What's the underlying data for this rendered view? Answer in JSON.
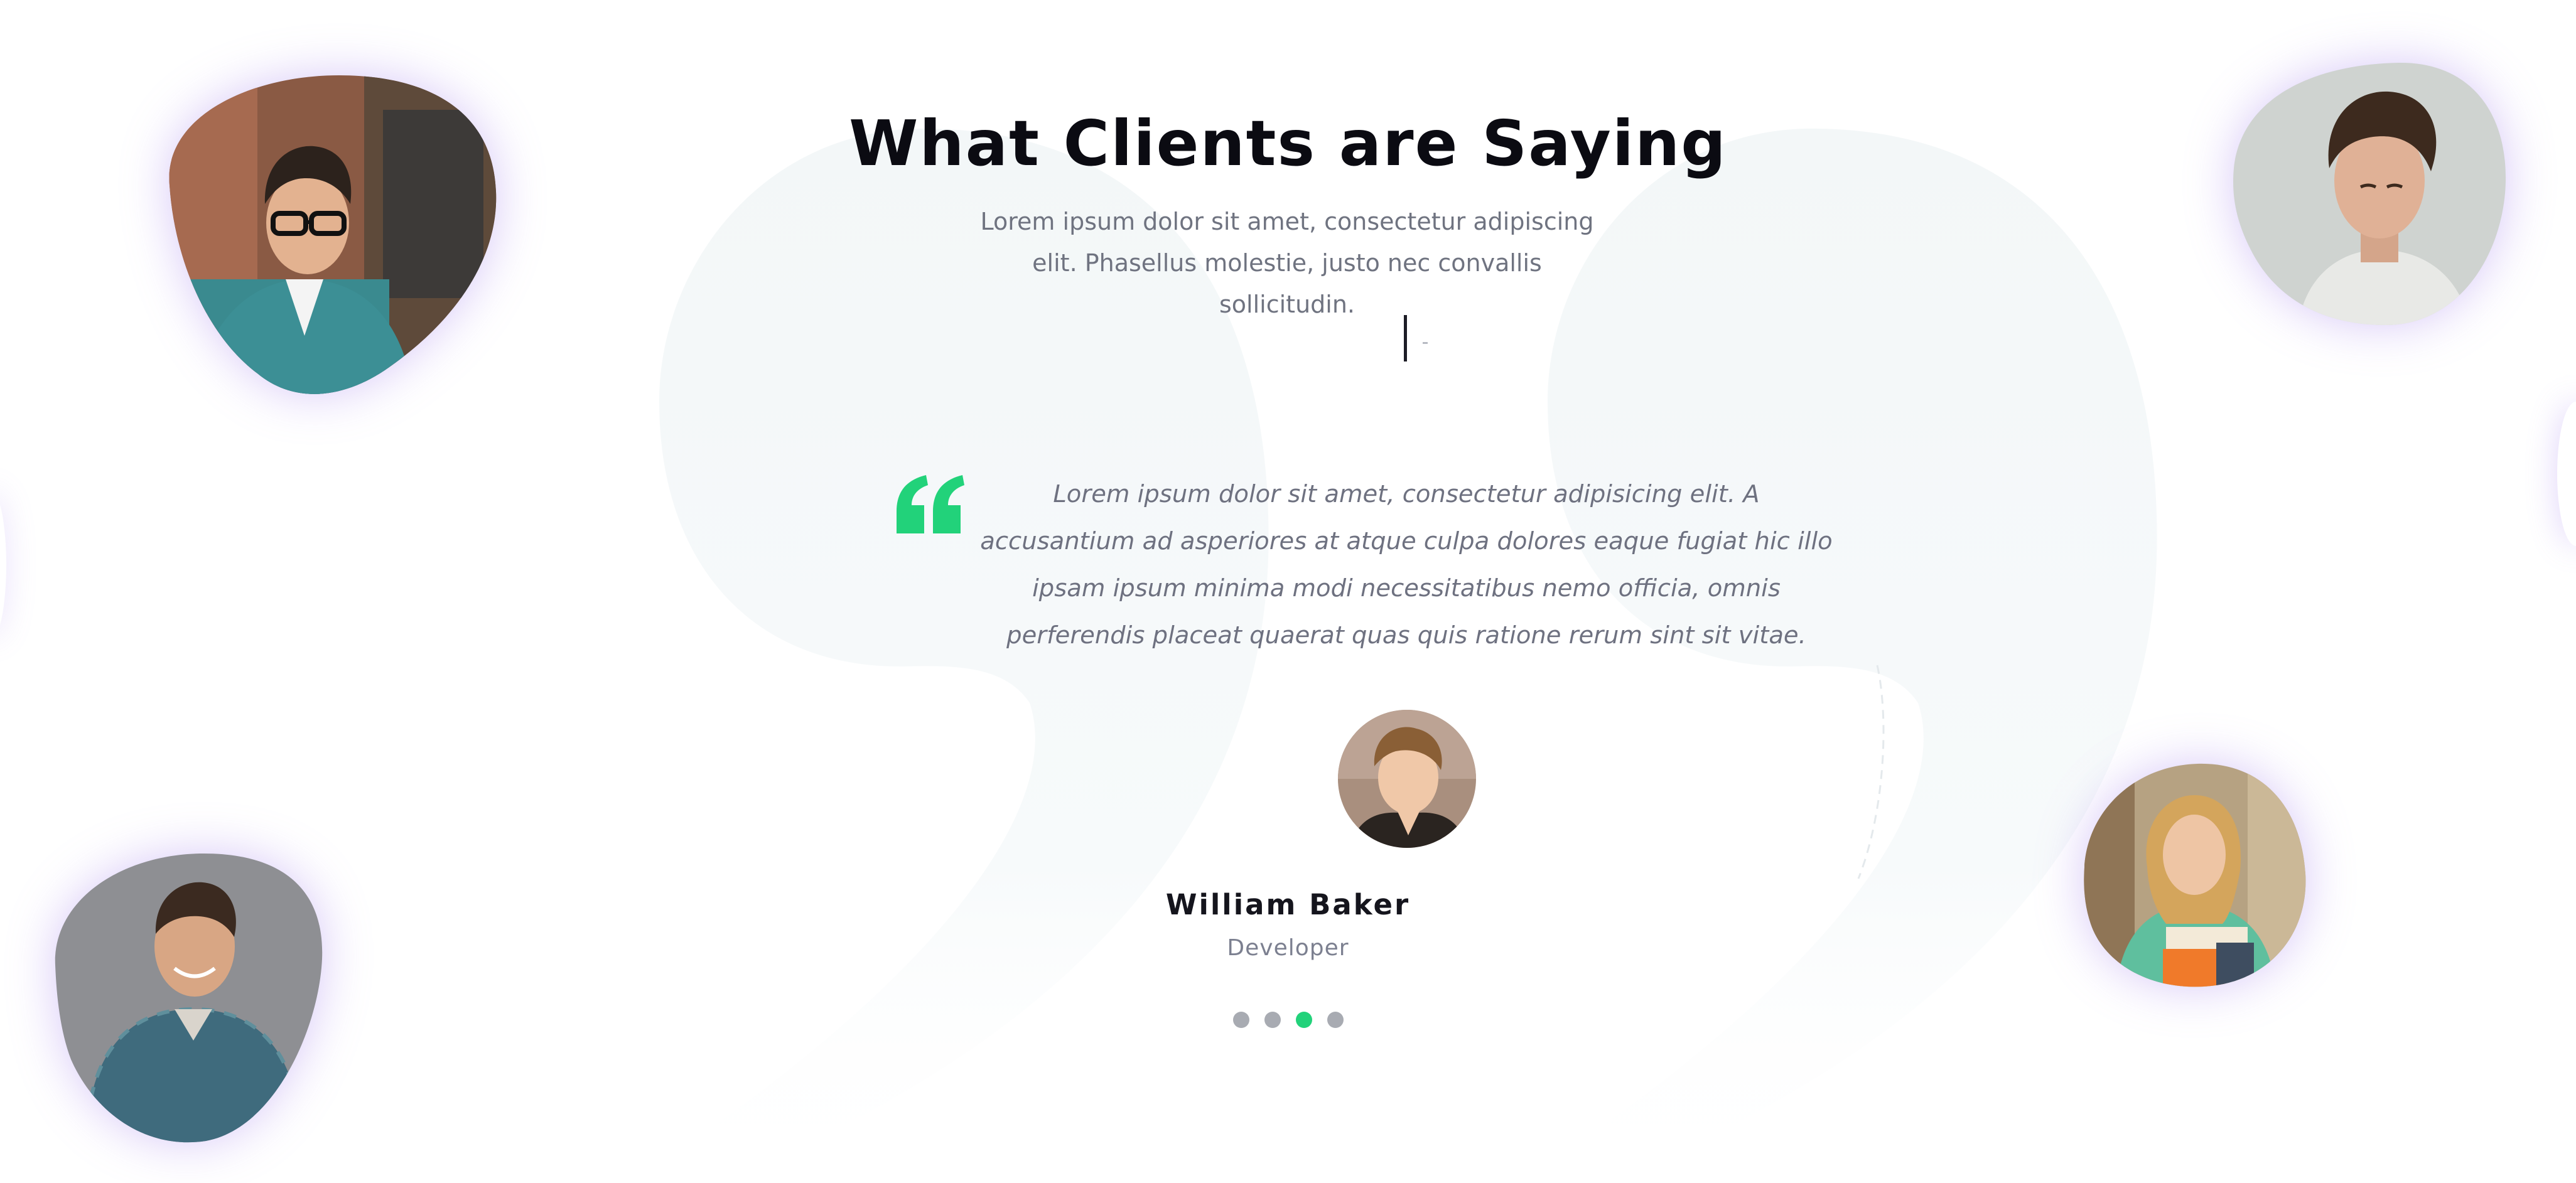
{
  "section": {
    "title": "What Clients are Saying",
    "subtitle": "Lorem ipsum dolor sit amet, consectetur adipiscing elit. Phasellus molestie, justo nec convallis sollicitudin."
  },
  "testimonial": {
    "quote": "Lorem ipsum dolor sit amet, consectetur adipisicing elit. A accusantium ad asperiores at atque culpa dolores eaque fugiat hic illo ipsam ipsum minima modi necessitatibus nemo officia, omnis perferendis placeat quaerat quas quis ratione rerum sint sit vitae.",
    "author_name": "William Baker",
    "author_role": "Developer",
    "quote_icon": "quote-icon"
  },
  "slider": {
    "total_slides": 4,
    "active_slide": 3
  },
  "colors": {
    "accent": "#22d27a",
    "title": "#0b0b12",
    "body_text": "#6f7380",
    "dot_inactive": "#a8abb2",
    "blob_glow": "#9a6eeb",
    "bg_quote": "#f4f8f9"
  },
  "client_photos": [
    {
      "name": "client-photo-glasses-man"
    },
    {
      "name": "client-photo-young-man"
    },
    {
      "name": "client-photo-plaid-shirt-man"
    },
    {
      "name": "client-photo-woman-with-books"
    }
  ]
}
